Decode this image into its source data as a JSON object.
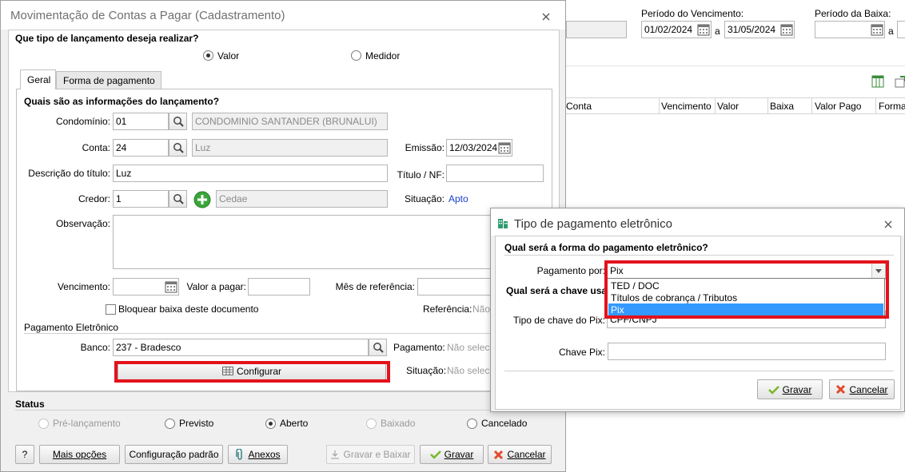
{
  "background": {
    "periodo_vencimento_label": "Período do Vencimento:",
    "periodo_baixa_label": "Período da Baixa:",
    "venc_from": "01/02/2024",
    "venc_sep": "a",
    "venc_to": "31/05/2024",
    "baixa_from": "",
    "baixa_sep": "a",
    "columns": [
      "Conta",
      "Vencimento",
      "Valor",
      "Baixa",
      "Valor Pago",
      "Forma"
    ]
  },
  "main_window": {
    "title": "Movimentação de Contas a Pagar (Cadastramento)",
    "tipo_question": "Que tipo de lançamento deseja realizar?",
    "opt_valor": "Valor",
    "opt_medidor": "Medidor",
    "tabs": [
      {
        "label": "Geral"
      },
      {
        "label": "Forma de pagamento"
      }
    ],
    "info_question": "Quais são as informações do lançamento?",
    "condominio_label": "Condomínio:",
    "condominio_code": "01",
    "condominio_name": "CONDOMINIO SANTANDER (BRUNALUI)",
    "conta_label": "Conta:",
    "conta_code": "24",
    "conta_name": "Luz",
    "emissao_label": "Emissão:",
    "emissao_value": "12/03/2024",
    "descricao_label": "Descrição do título:",
    "descricao_value": "Luz",
    "titulo_label": "Título / NF:",
    "titulo_value": "",
    "credor_label": "Credor:",
    "credor_code": "1",
    "credor_name": "Cedae",
    "situacao_label": "Situação:",
    "situacao_value": "Apto",
    "observacao_label": "Observação:",
    "vencimento_label": "Vencimento:",
    "valor_pagar_label": "Valor a pagar:",
    "mes_ref_label": "Mês de referência:",
    "bloquear_label": "Bloquear baixa deste documento",
    "referencia_label": "Referência:",
    "referencia_value": "Não",
    "pag_eletronico_title": "Pagamento Eletrônico",
    "banco_label": "Banco:",
    "banco_value": "237 - Bradesco",
    "pagamento_label": "Pagamento:",
    "pagamento_value": "Não selecionado",
    "configurar_label": "Configurar",
    "situacao2_label": "Situação:",
    "situacao2_value": "Não selecionado",
    "status_title": "Status",
    "status_options": [
      "Pré-lançamento",
      "Previsto",
      "Aberto",
      "Baixado",
      "Cancelado"
    ],
    "help_label": "?",
    "mais_opcoes": "Mais opções",
    "config_padrao": "Configuração padrão",
    "anexos": "Anexos",
    "gravar_baixar": "Gravar e Baixar",
    "gravar": "Gravar",
    "cancelar": "Cancelar"
  },
  "dialog": {
    "title": "Tipo de pagamento eletrônico",
    "question1": "Qual será a forma do pagamento eletrônico?",
    "pagamento_por_label": "Pagamento por:",
    "pagamento_por_value": "Pix",
    "options": [
      "TED / DOC",
      "Títulos de cobrança / Tributos",
      "Pix"
    ],
    "question2": "Qual será a chave usada",
    "tipo_chave_label": "Tipo de chave do Pix:",
    "tipo_chave_value": "CPF/CNPJ",
    "chave_label": "Chave Pix:",
    "chave_value": "",
    "gravar": "Gravar",
    "cancelar": "Cancelar"
  },
  "colors": {
    "highlight_red": "#e3121b",
    "selection_blue": "#3399ff",
    "situacao_blue": "#1a3fc9",
    "add_green": "#3aa63a"
  }
}
